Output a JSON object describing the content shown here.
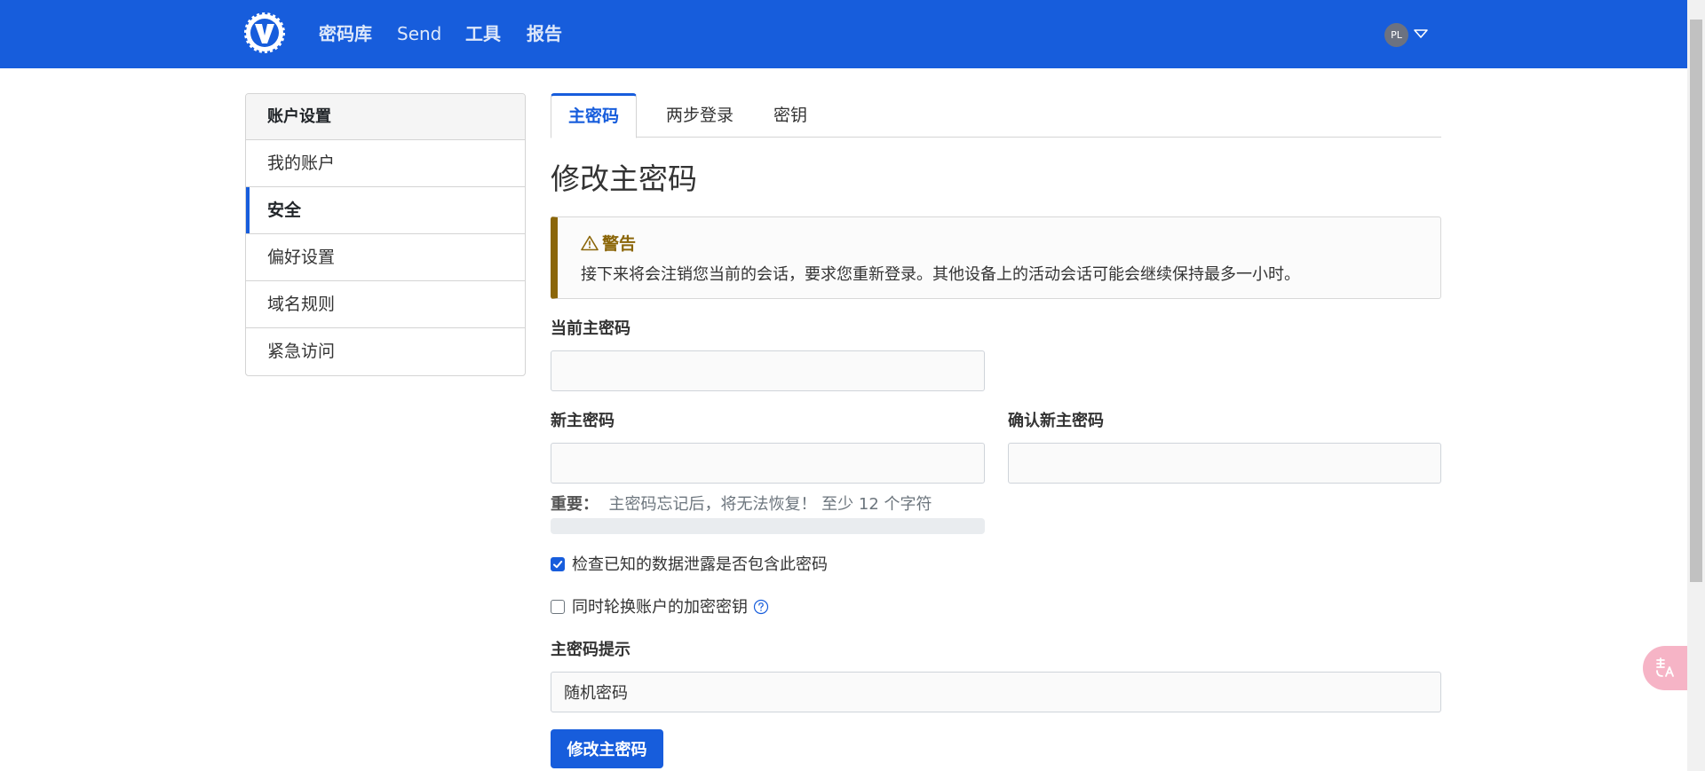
{
  "nav": {
    "items": [
      "密码库",
      "Send",
      "工具",
      "报告"
    ],
    "avatar_initials": "PL"
  },
  "sidebar": {
    "header": "账户设置",
    "items": [
      {
        "label": "我的账户",
        "active": false
      },
      {
        "label": "安全",
        "active": true
      },
      {
        "label": "偏好设置",
        "active": false
      },
      {
        "label": "域名规则",
        "active": false
      },
      {
        "label": "紧急访问",
        "active": false
      }
    ]
  },
  "tabs": [
    {
      "label": "主密码",
      "active": true
    },
    {
      "label": "两步登录",
      "active": false
    },
    {
      "label": "密钥",
      "active": false
    }
  ],
  "page_title": "修改主密码",
  "warning": {
    "title": "警告",
    "text": "接下来将会注销您当前的会话，要求您重新登录。其他设备上的活动会话可能会继续保持最多一小时。"
  },
  "form": {
    "current_password_label": "当前主密码",
    "current_password_value": "",
    "new_password_label": "新主密码",
    "new_password_value": "",
    "confirm_password_label": "确认新主密码",
    "confirm_password_value": "",
    "hint_important": "重要：",
    "hint_text": "主密码忘记后，将无法恢复！ 至少 12 个字符",
    "strength_fraction": 0,
    "check_breach_label": "检查已知的数据泄露是否包含此密码",
    "check_breach_checked": true,
    "rotate_key_label": "同时轮换账户的加密密钥",
    "rotate_key_checked": false,
    "password_hint_label": "主密码提示",
    "password_hint_value": "随机密码",
    "submit_label": "修改主密码"
  },
  "colors": {
    "brand": "#175ddc",
    "warning": "#8b6609"
  },
  "icons": [
    "bitwarden-logo-icon",
    "chevron-down-icon",
    "warning-icon",
    "checkmark-icon",
    "help-icon",
    "translate-icon"
  ]
}
